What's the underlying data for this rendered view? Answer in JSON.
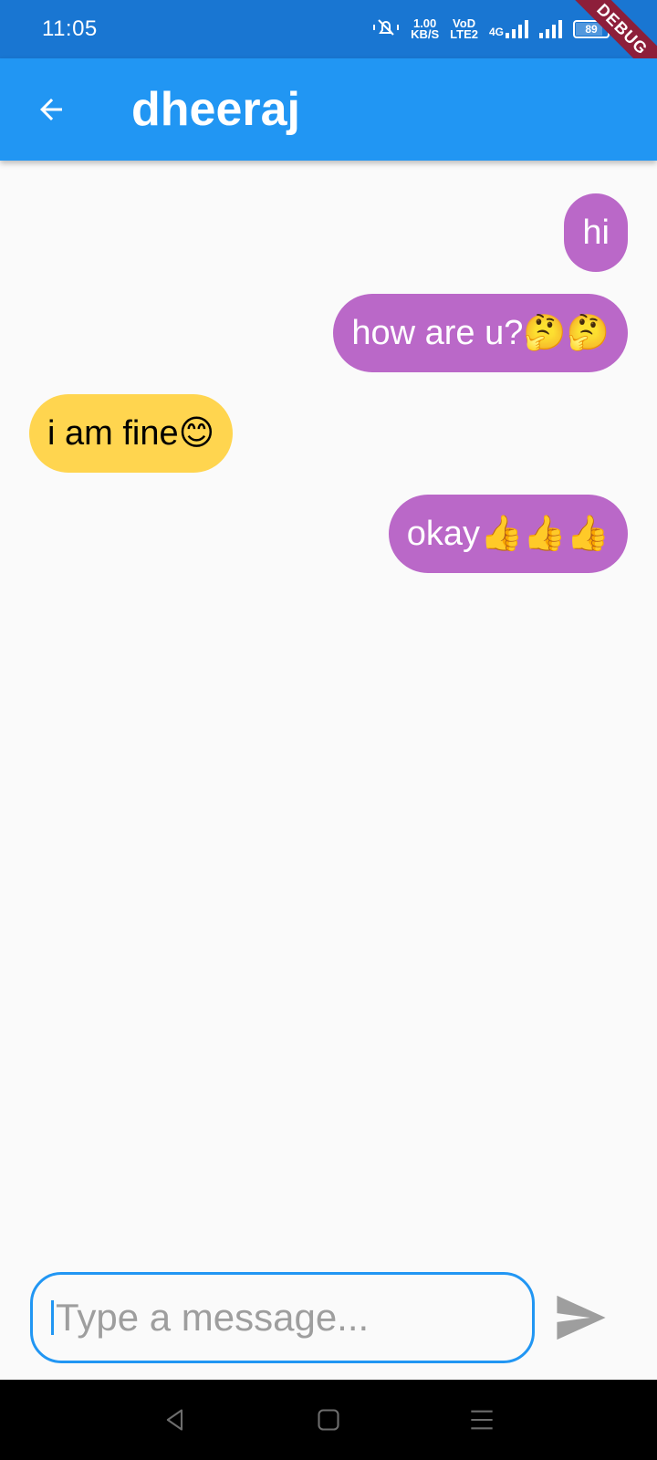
{
  "status_bar": {
    "time": "11:05",
    "speed_value": "1.00",
    "speed_unit": "KB/S",
    "volte_label": "VoD",
    "lte_label": "LTE2",
    "network_label": "4G",
    "battery": "89"
  },
  "debug_banner": "DEBUG",
  "app_bar": {
    "title": "dheeraj",
    "back_icon": "arrow-back-icon"
  },
  "messages": [
    {
      "text": "hi",
      "direction": "sent"
    },
    {
      "text": "how are u?🤔🤔",
      "direction": "sent"
    },
    {
      "text": "i am fine😊",
      "direction": "received"
    },
    {
      "text": "okay👍👍👍",
      "direction": "sent"
    }
  ],
  "composer": {
    "placeholder": "Type a message...",
    "value": "",
    "send_icon": "send-icon"
  },
  "colors": {
    "status_bar": "#1976d2",
    "app_bar": "#2196f3",
    "sent_bubble": "#ba68c8",
    "received_bubble": "#ffd54f",
    "debug_ribbon": "#8d1f3a"
  },
  "nav_bar": {
    "back": "nav-back-icon",
    "home": "nav-home-icon",
    "menu": "nav-menu-icon"
  }
}
